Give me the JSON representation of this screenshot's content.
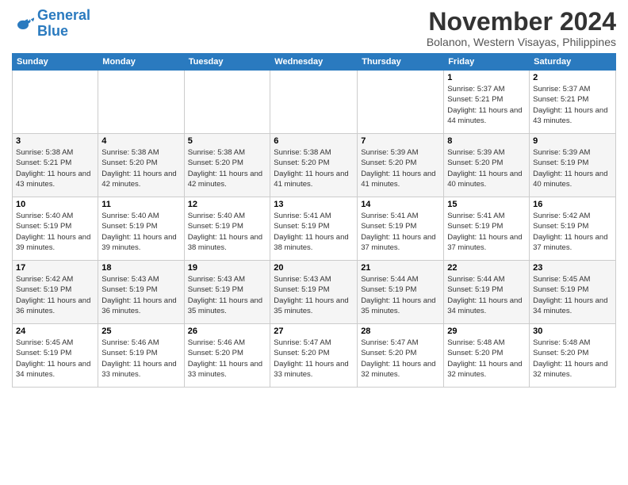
{
  "header": {
    "logo_line1": "General",
    "logo_line2": "Blue",
    "month": "November 2024",
    "location": "Bolanon, Western Visayas, Philippines"
  },
  "weekdays": [
    "Sunday",
    "Monday",
    "Tuesday",
    "Wednesday",
    "Thursday",
    "Friday",
    "Saturday"
  ],
  "weeks": [
    [
      {
        "day": "",
        "text": ""
      },
      {
        "day": "",
        "text": ""
      },
      {
        "day": "",
        "text": ""
      },
      {
        "day": "",
        "text": ""
      },
      {
        "day": "",
        "text": ""
      },
      {
        "day": "1",
        "text": "Sunrise: 5:37 AM\nSunset: 5:21 PM\nDaylight: 11 hours and 44 minutes."
      },
      {
        "day": "2",
        "text": "Sunrise: 5:37 AM\nSunset: 5:21 PM\nDaylight: 11 hours and 43 minutes."
      }
    ],
    [
      {
        "day": "3",
        "text": "Sunrise: 5:38 AM\nSunset: 5:21 PM\nDaylight: 11 hours and 43 minutes."
      },
      {
        "day": "4",
        "text": "Sunrise: 5:38 AM\nSunset: 5:20 PM\nDaylight: 11 hours and 42 minutes."
      },
      {
        "day": "5",
        "text": "Sunrise: 5:38 AM\nSunset: 5:20 PM\nDaylight: 11 hours and 42 minutes."
      },
      {
        "day": "6",
        "text": "Sunrise: 5:38 AM\nSunset: 5:20 PM\nDaylight: 11 hours and 41 minutes."
      },
      {
        "day": "7",
        "text": "Sunrise: 5:39 AM\nSunset: 5:20 PM\nDaylight: 11 hours and 41 minutes."
      },
      {
        "day": "8",
        "text": "Sunrise: 5:39 AM\nSunset: 5:20 PM\nDaylight: 11 hours and 40 minutes."
      },
      {
        "day": "9",
        "text": "Sunrise: 5:39 AM\nSunset: 5:19 PM\nDaylight: 11 hours and 40 minutes."
      }
    ],
    [
      {
        "day": "10",
        "text": "Sunrise: 5:40 AM\nSunset: 5:19 PM\nDaylight: 11 hours and 39 minutes."
      },
      {
        "day": "11",
        "text": "Sunrise: 5:40 AM\nSunset: 5:19 PM\nDaylight: 11 hours and 39 minutes."
      },
      {
        "day": "12",
        "text": "Sunrise: 5:40 AM\nSunset: 5:19 PM\nDaylight: 11 hours and 38 minutes."
      },
      {
        "day": "13",
        "text": "Sunrise: 5:41 AM\nSunset: 5:19 PM\nDaylight: 11 hours and 38 minutes."
      },
      {
        "day": "14",
        "text": "Sunrise: 5:41 AM\nSunset: 5:19 PM\nDaylight: 11 hours and 37 minutes."
      },
      {
        "day": "15",
        "text": "Sunrise: 5:41 AM\nSunset: 5:19 PM\nDaylight: 11 hours and 37 minutes."
      },
      {
        "day": "16",
        "text": "Sunrise: 5:42 AM\nSunset: 5:19 PM\nDaylight: 11 hours and 37 minutes."
      }
    ],
    [
      {
        "day": "17",
        "text": "Sunrise: 5:42 AM\nSunset: 5:19 PM\nDaylight: 11 hours and 36 minutes."
      },
      {
        "day": "18",
        "text": "Sunrise: 5:43 AM\nSunset: 5:19 PM\nDaylight: 11 hours and 36 minutes."
      },
      {
        "day": "19",
        "text": "Sunrise: 5:43 AM\nSunset: 5:19 PM\nDaylight: 11 hours and 35 minutes."
      },
      {
        "day": "20",
        "text": "Sunrise: 5:43 AM\nSunset: 5:19 PM\nDaylight: 11 hours and 35 minutes."
      },
      {
        "day": "21",
        "text": "Sunrise: 5:44 AM\nSunset: 5:19 PM\nDaylight: 11 hours and 35 minutes."
      },
      {
        "day": "22",
        "text": "Sunrise: 5:44 AM\nSunset: 5:19 PM\nDaylight: 11 hours and 34 minutes."
      },
      {
        "day": "23",
        "text": "Sunrise: 5:45 AM\nSunset: 5:19 PM\nDaylight: 11 hours and 34 minutes."
      }
    ],
    [
      {
        "day": "24",
        "text": "Sunrise: 5:45 AM\nSunset: 5:19 PM\nDaylight: 11 hours and 34 minutes."
      },
      {
        "day": "25",
        "text": "Sunrise: 5:46 AM\nSunset: 5:19 PM\nDaylight: 11 hours and 33 minutes."
      },
      {
        "day": "26",
        "text": "Sunrise: 5:46 AM\nSunset: 5:20 PM\nDaylight: 11 hours and 33 minutes."
      },
      {
        "day": "27",
        "text": "Sunrise: 5:47 AM\nSunset: 5:20 PM\nDaylight: 11 hours and 33 minutes."
      },
      {
        "day": "28",
        "text": "Sunrise: 5:47 AM\nSunset: 5:20 PM\nDaylight: 11 hours and 32 minutes."
      },
      {
        "day": "29",
        "text": "Sunrise: 5:48 AM\nSunset: 5:20 PM\nDaylight: 11 hours and 32 minutes."
      },
      {
        "day": "30",
        "text": "Sunrise: 5:48 AM\nSunset: 5:20 PM\nDaylight: 11 hours and 32 minutes."
      }
    ]
  ]
}
